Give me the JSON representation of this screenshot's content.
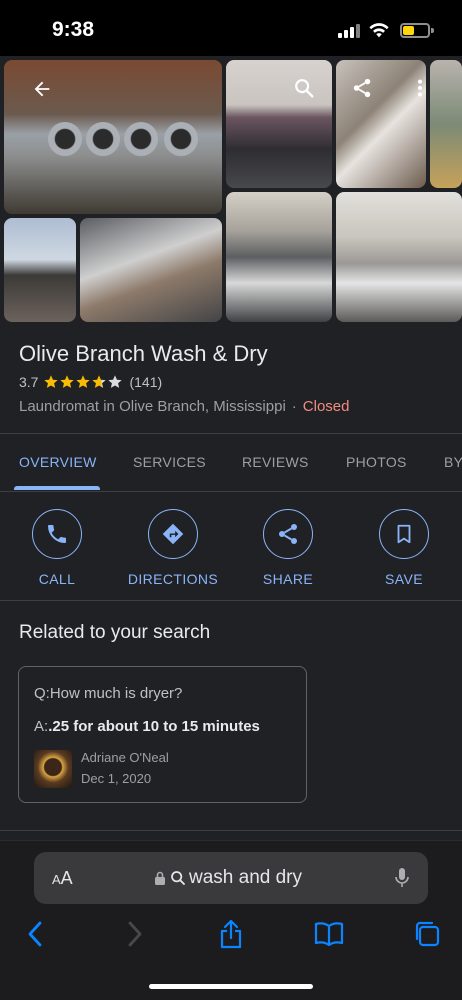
{
  "status_bar": {
    "time": "9:38"
  },
  "place": {
    "name": "Olive Branch Wash & Dry",
    "rating": "3.7",
    "rating_value": 3.7,
    "review_count": "(141)",
    "category": "Laundromat in Olive Branch, Mississippi",
    "separator": "·",
    "status": "Closed"
  },
  "tabs": [
    "OVERVIEW",
    "SERVICES",
    "REVIEWS",
    "PHOTOS",
    "BY"
  ],
  "actions": {
    "call": "CALL",
    "directions": "DIRECTIONS",
    "share": "SHARE",
    "save": "SAVE"
  },
  "related": {
    "title": "Related to your search",
    "question": "Q:How much is dryer?",
    "answer_prefix": "A:",
    "answer": ".25 for about 10 to 15 minutes",
    "author": "Adriane O'Neal",
    "date": "Dec 1, 2020"
  },
  "safari": {
    "aa_label": "AA",
    "url_text": "wash and dry"
  },
  "colors": {
    "accent": "#8ab4f8",
    "closed": "#f28b82",
    "star": "#fbbc04",
    "background": "#202124"
  },
  "icons": [
    "back-arrow-icon",
    "search-icon",
    "share-icon",
    "more-icon",
    "phone-icon",
    "directions-icon",
    "share-icon",
    "bookmark-icon",
    "lock-icon",
    "search-icon",
    "microphone-icon",
    "chevron-left-icon",
    "chevron-right-icon",
    "share-upload-icon",
    "book-icon",
    "tabs-icon"
  ]
}
